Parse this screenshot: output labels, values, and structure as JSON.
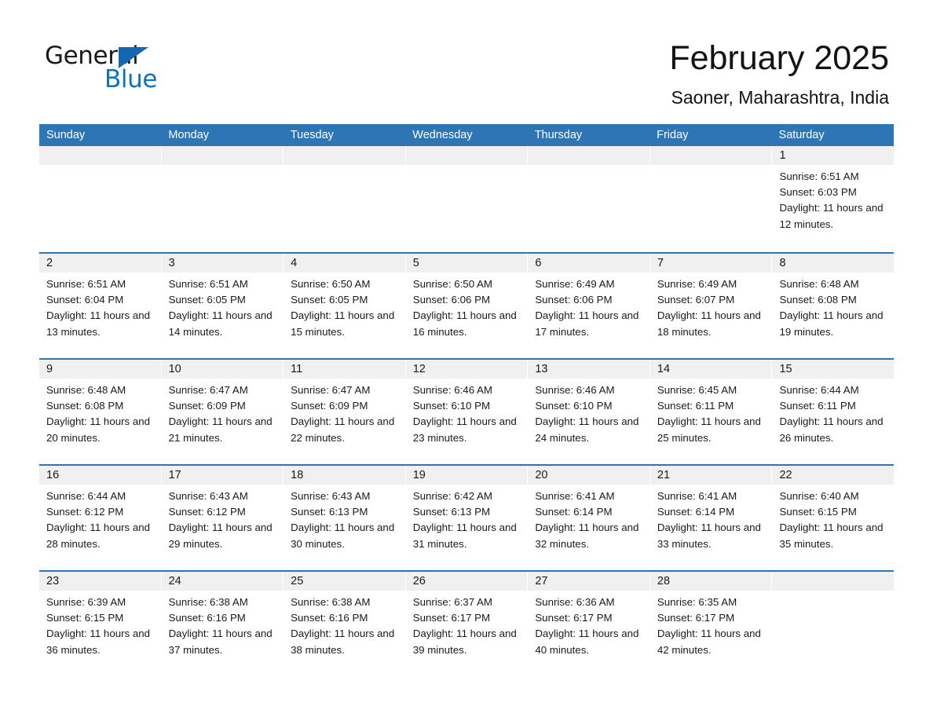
{
  "brand": {
    "name_part1": "General",
    "name_part2": "Blue"
  },
  "header": {
    "month_title": "February 2025",
    "location": "Saoner, Maharashtra, India"
  },
  "colors": {
    "header_blue": "#2e75b6",
    "logo_blue": "#1072bd",
    "day_strip_gray": "#f0f0f0"
  },
  "weekdays": [
    "Sunday",
    "Monday",
    "Tuesday",
    "Wednesday",
    "Thursday",
    "Friday",
    "Saturday"
  ],
  "weeks": [
    [
      {
        "day": "",
        "sunrise": "",
        "sunset": "",
        "daylight": ""
      },
      {
        "day": "",
        "sunrise": "",
        "sunset": "",
        "daylight": ""
      },
      {
        "day": "",
        "sunrise": "",
        "sunset": "",
        "daylight": ""
      },
      {
        "day": "",
        "sunrise": "",
        "sunset": "",
        "daylight": ""
      },
      {
        "day": "",
        "sunrise": "",
        "sunset": "",
        "daylight": ""
      },
      {
        "day": "",
        "sunrise": "",
        "sunset": "",
        "daylight": ""
      },
      {
        "day": "1",
        "sunrise": "Sunrise: 6:51 AM",
        "sunset": "Sunset: 6:03 PM",
        "daylight": "Daylight: 11 hours and 12 minutes."
      }
    ],
    [
      {
        "day": "2",
        "sunrise": "Sunrise: 6:51 AM",
        "sunset": "Sunset: 6:04 PM",
        "daylight": "Daylight: 11 hours and 13 minutes."
      },
      {
        "day": "3",
        "sunrise": "Sunrise: 6:51 AM",
        "sunset": "Sunset: 6:05 PM",
        "daylight": "Daylight: 11 hours and 14 minutes."
      },
      {
        "day": "4",
        "sunrise": "Sunrise: 6:50 AM",
        "sunset": "Sunset: 6:05 PM",
        "daylight": "Daylight: 11 hours and 15 minutes."
      },
      {
        "day": "5",
        "sunrise": "Sunrise: 6:50 AM",
        "sunset": "Sunset: 6:06 PM",
        "daylight": "Daylight: 11 hours and 16 minutes."
      },
      {
        "day": "6",
        "sunrise": "Sunrise: 6:49 AM",
        "sunset": "Sunset: 6:06 PM",
        "daylight": "Daylight: 11 hours and 17 minutes."
      },
      {
        "day": "7",
        "sunrise": "Sunrise: 6:49 AM",
        "sunset": "Sunset: 6:07 PM",
        "daylight": "Daylight: 11 hours and 18 minutes."
      },
      {
        "day": "8",
        "sunrise": "Sunrise: 6:48 AM",
        "sunset": "Sunset: 6:08 PM",
        "daylight": "Daylight: 11 hours and 19 minutes."
      }
    ],
    [
      {
        "day": "9",
        "sunrise": "Sunrise: 6:48 AM",
        "sunset": "Sunset: 6:08 PM",
        "daylight": "Daylight: 11 hours and 20 minutes."
      },
      {
        "day": "10",
        "sunrise": "Sunrise: 6:47 AM",
        "sunset": "Sunset: 6:09 PM",
        "daylight": "Daylight: 11 hours and 21 minutes."
      },
      {
        "day": "11",
        "sunrise": "Sunrise: 6:47 AM",
        "sunset": "Sunset: 6:09 PM",
        "daylight": "Daylight: 11 hours and 22 minutes."
      },
      {
        "day": "12",
        "sunrise": "Sunrise: 6:46 AM",
        "sunset": "Sunset: 6:10 PM",
        "daylight": "Daylight: 11 hours and 23 minutes."
      },
      {
        "day": "13",
        "sunrise": "Sunrise: 6:46 AM",
        "sunset": "Sunset: 6:10 PM",
        "daylight": "Daylight: 11 hours and 24 minutes."
      },
      {
        "day": "14",
        "sunrise": "Sunrise: 6:45 AM",
        "sunset": "Sunset: 6:11 PM",
        "daylight": "Daylight: 11 hours and 25 minutes."
      },
      {
        "day": "15",
        "sunrise": "Sunrise: 6:44 AM",
        "sunset": "Sunset: 6:11 PM",
        "daylight": "Daylight: 11 hours and 26 minutes."
      }
    ],
    [
      {
        "day": "16",
        "sunrise": "Sunrise: 6:44 AM",
        "sunset": "Sunset: 6:12 PM",
        "daylight": "Daylight: 11 hours and 28 minutes."
      },
      {
        "day": "17",
        "sunrise": "Sunrise: 6:43 AM",
        "sunset": "Sunset: 6:12 PM",
        "daylight": "Daylight: 11 hours and 29 minutes."
      },
      {
        "day": "18",
        "sunrise": "Sunrise: 6:43 AM",
        "sunset": "Sunset: 6:13 PM",
        "daylight": "Daylight: 11 hours and 30 minutes."
      },
      {
        "day": "19",
        "sunrise": "Sunrise: 6:42 AM",
        "sunset": "Sunset: 6:13 PM",
        "daylight": "Daylight: 11 hours and 31 minutes."
      },
      {
        "day": "20",
        "sunrise": "Sunrise: 6:41 AM",
        "sunset": "Sunset: 6:14 PM",
        "daylight": "Daylight: 11 hours and 32 minutes."
      },
      {
        "day": "21",
        "sunrise": "Sunrise: 6:41 AM",
        "sunset": "Sunset: 6:14 PM",
        "daylight": "Daylight: 11 hours and 33 minutes."
      },
      {
        "day": "22",
        "sunrise": "Sunrise: 6:40 AM",
        "sunset": "Sunset: 6:15 PM",
        "daylight": "Daylight: 11 hours and 35 minutes."
      }
    ],
    [
      {
        "day": "23",
        "sunrise": "Sunrise: 6:39 AM",
        "sunset": "Sunset: 6:15 PM",
        "daylight": "Daylight: 11 hours and 36 minutes."
      },
      {
        "day": "24",
        "sunrise": "Sunrise: 6:38 AM",
        "sunset": "Sunset: 6:16 PM",
        "daylight": "Daylight: 11 hours and 37 minutes."
      },
      {
        "day": "25",
        "sunrise": "Sunrise: 6:38 AM",
        "sunset": "Sunset: 6:16 PM",
        "daylight": "Daylight: 11 hours and 38 minutes."
      },
      {
        "day": "26",
        "sunrise": "Sunrise: 6:37 AM",
        "sunset": "Sunset: 6:17 PM",
        "daylight": "Daylight: 11 hours and 39 minutes."
      },
      {
        "day": "27",
        "sunrise": "Sunrise: 6:36 AM",
        "sunset": "Sunset: 6:17 PM",
        "daylight": "Daylight: 11 hours and 40 minutes."
      },
      {
        "day": "28",
        "sunrise": "Sunrise: 6:35 AM",
        "sunset": "Sunset: 6:17 PM",
        "daylight": "Daylight: 11 hours and 42 minutes."
      },
      {
        "day": "",
        "sunrise": "",
        "sunset": "",
        "daylight": ""
      }
    ]
  ]
}
